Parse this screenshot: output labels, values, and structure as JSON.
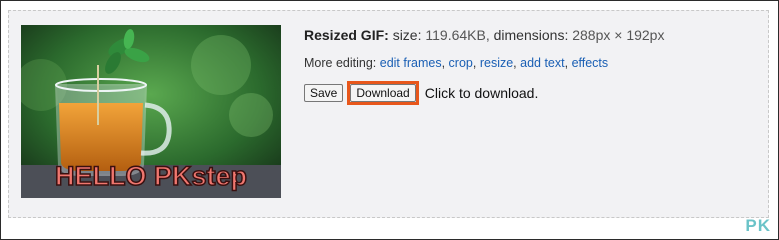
{
  "result": {
    "line1_label": "Resized GIF:",
    "size_label": "size:",
    "size_value": "119.64KB",
    "dimensions_label": "dimensions:",
    "dimensions_value": "288px × 192px",
    "more_editing_label": "More editing:",
    "links": [
      "edit frames",
      "crop",
      "resize",
      "add text",
      "effects"
    ],
    "save_label": "Save",
    "download_label": "Download",
    "download_hint": "Click to download.",
    "image_text": "HELLO PKstep",
    "highlight_color": "#e8571b",
    "link_color": "#1a5fb4"
  },
  "watermark": "PK"
}
